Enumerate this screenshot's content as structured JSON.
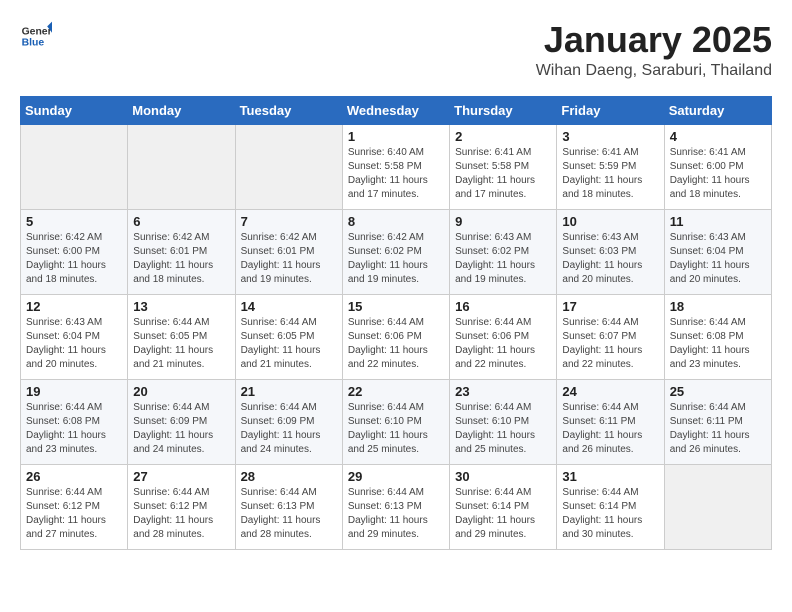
{
  "header": {
    "logo_general": "General",
    "logo_blue": "Blue",
    "title": "January 2025",
    "subtitle": "Wihan Daeng, Saraburi, Thailand"
  },
  "weekdays": [
    "Sunday",
    "Monday",
    "Tuesday",
    "Wednesday",
    "Thursday",
    "Friday",
    "Saturday"
  ],
  "weeks": [
    [
      {
        "day": "",
        "empty": true
      },
      {
        "day": "",
        "empty": true
      },
      {
        "day": "",
        "empty": true
      },
      {
        "day": "1",
        "sunrise": "6:40 AM",
        "sunset": "5:58 PM",
        "daylight": "11 hours and 17 minutes."
      },
      {
        "day": "2",
        "sunrise": "6:41 AM",
        "sunset": "5:58 PM",
        "daylight": "11 hours and 17 minutes."
      },
      {
        "day": "3",
        "sunrise": "6:41 AM",
        "sunset": "5:59 PM",
        "daylight": "11 hours and 18 minutes."
      },
      {
        "day": "4",
        "sunrise": "6:41 AM",
        "sunset": "6:00 PM",
        "daylight": "11 hours and 18 minutes."
      }
    ],
    [
      {
        "day": "5",
        "sunrise": "6:42 AM",
        "sunset": "6:00 PM",
        "daylight": "11 hours and 18 minutes."
      },
      {
        "day": "6",
        "sunrise": "6:42 AM",
        "sunset": "6:01 PM",
        "daylight": "11 hours and 18 minutes."
      },
      {
        "day": "7",
        "sunrise": "6:42 AM",
        "sunset": "6:01 PM",
        "daylight": "11 hours and 19 minutes."
      },
      {
        "day": "8",
        "sunrise": "6:42 AM",
        "sunset": "6:02 PM",
        "daylight": "11 hours and 19 minutes."
      },
      {
        "day": "9",
        "sunrise": "6:43 AM",
        "sunset": "6:02 PM",
        "daylight": "11 hours and 19 minutes."
      },
      {
        "day": "10",
        "sunrise": "6:43 AM",
        "sunset": "6:03 PM",
        "daylight": "11 hours and 20 minutes."
      },
      {
        "day": "11",
        "sunrise": "6:43 AM",
        "sunset": "6:04 PM",
        "daylight": "11 hours and 20 minutes."
      }
    ],
    [
      {
        "day": "12",
        "sunrise": "6:43 AM",
        "sunset": "6:04 PM",
        "daylight": "11 hours and 20 minutes."
      },
      {
        "day": "13",
        "sunrise": "6:44 AM",
        "sunset": "6:05 PM",
        "daylight": "11 hours and 21 minutes."
      },
      {
        "day": "14",
        "sunrise": "6:44 AM",
        "sunset": "6:05 PM",
        "daylight": "11 hours and 21 minutes."
      },
      {
        "day": "15",
        "sunrise": "6:44 AM",
        "sunset": "6:06 PM",
        "daylight": "11 hours and 22 minutes."
      },
      {
        "day": "16",
        "sunrise": "6:44 AM",
        "sunset": "6:06 PM",
        "daylight": "11 hours and 22 minutes."
      },
      {
        "day": "17",
        "sunrise": "6:44 AM",
        "sunset": "6:07 PM",
        "daylight": "11 hours and 22 minutes."
      },
      {
        "day": "18",
        "sunrise": "6:44 AM",
        "sunset": "6:08 PM",
        "daylight": "11 hours and 23 minutes."
      }
    ],
    [
      {
        "day": "19",
        "sunrise": "6:44 AM",
        "sunset": "6:08 PM",
        "daylight": "11 hours and 23 minutes."
      },
      {
        "day": "20",
        "sunrise": "6:44 AM",
        "sunset": "6:09 PM",
        "daylight": "11 hours and 24 minutes."
      },
      {
        "day": "21",
        "sunrise": "6:44 AM",
        "sunset": "6:09 PM",
        "daylight": "11 hours and 24 minutes."
      },
      {
        "day": "22",
        "sunrise": "6:44 AM",
        "sunset": "6:10 PM",
        "daylight": "11 hours and 25 minutes."
      },
      {
        "day": "23",
        "sunrise": "6:44 AM",
        "sunset": "6:10 PM",
        "daylight": "11 hours and 25 minutes."
      },
      {
        "day": "24",
        "sunrise": "6:44 AM",
        "sunset": "6:11 PM",
        "daylight": "11 hours and 26 minutes."
      },
      {
        "day": "25",
        "sunrise": "6:44 AM",
        "sunset": "6:11 PM",
        "daylight": "11 hours and 26 minutes."
      }
    ],
    [
      {
        "day": "26",
        "sunrise": "6:44 AM",
        "sunset": "6:12 PM",
        "daylight": "11 hours and 27 minutes."
      },
      {
        "day": "27",
        "sunrise": "6:44 AM",
        "sunset": "6:12 PM",
        "daylight": "11 hours and 28 minutes."
      },
      {
        "day": "28",
        "sunrise": "6:44 AM",
        "sunset": "6:13 PM",
        "daylight": "11 hours and 28 minutes."
      },
      {
        "day": "29",
        "sunrise": "6:44 AM",
        "sunset": "6:13 PM",
        "daylight": "11 hours and 29 minutes."
      },
      {
        "day": "30",
        "sunrise": "6:44 AM",
        "sunset": "6:14 PM",
        "daylight": "11 hours and 29 minutes."
      },
      {
        "day": "31",
        "sunrise": "6:44 AM",
        "sunset": "6:14 PM",
        "daylight": "11 hours and 30 minutes."
      },
      {
        "day": "",
        "empty": true
      }
    ]
  ]
}
